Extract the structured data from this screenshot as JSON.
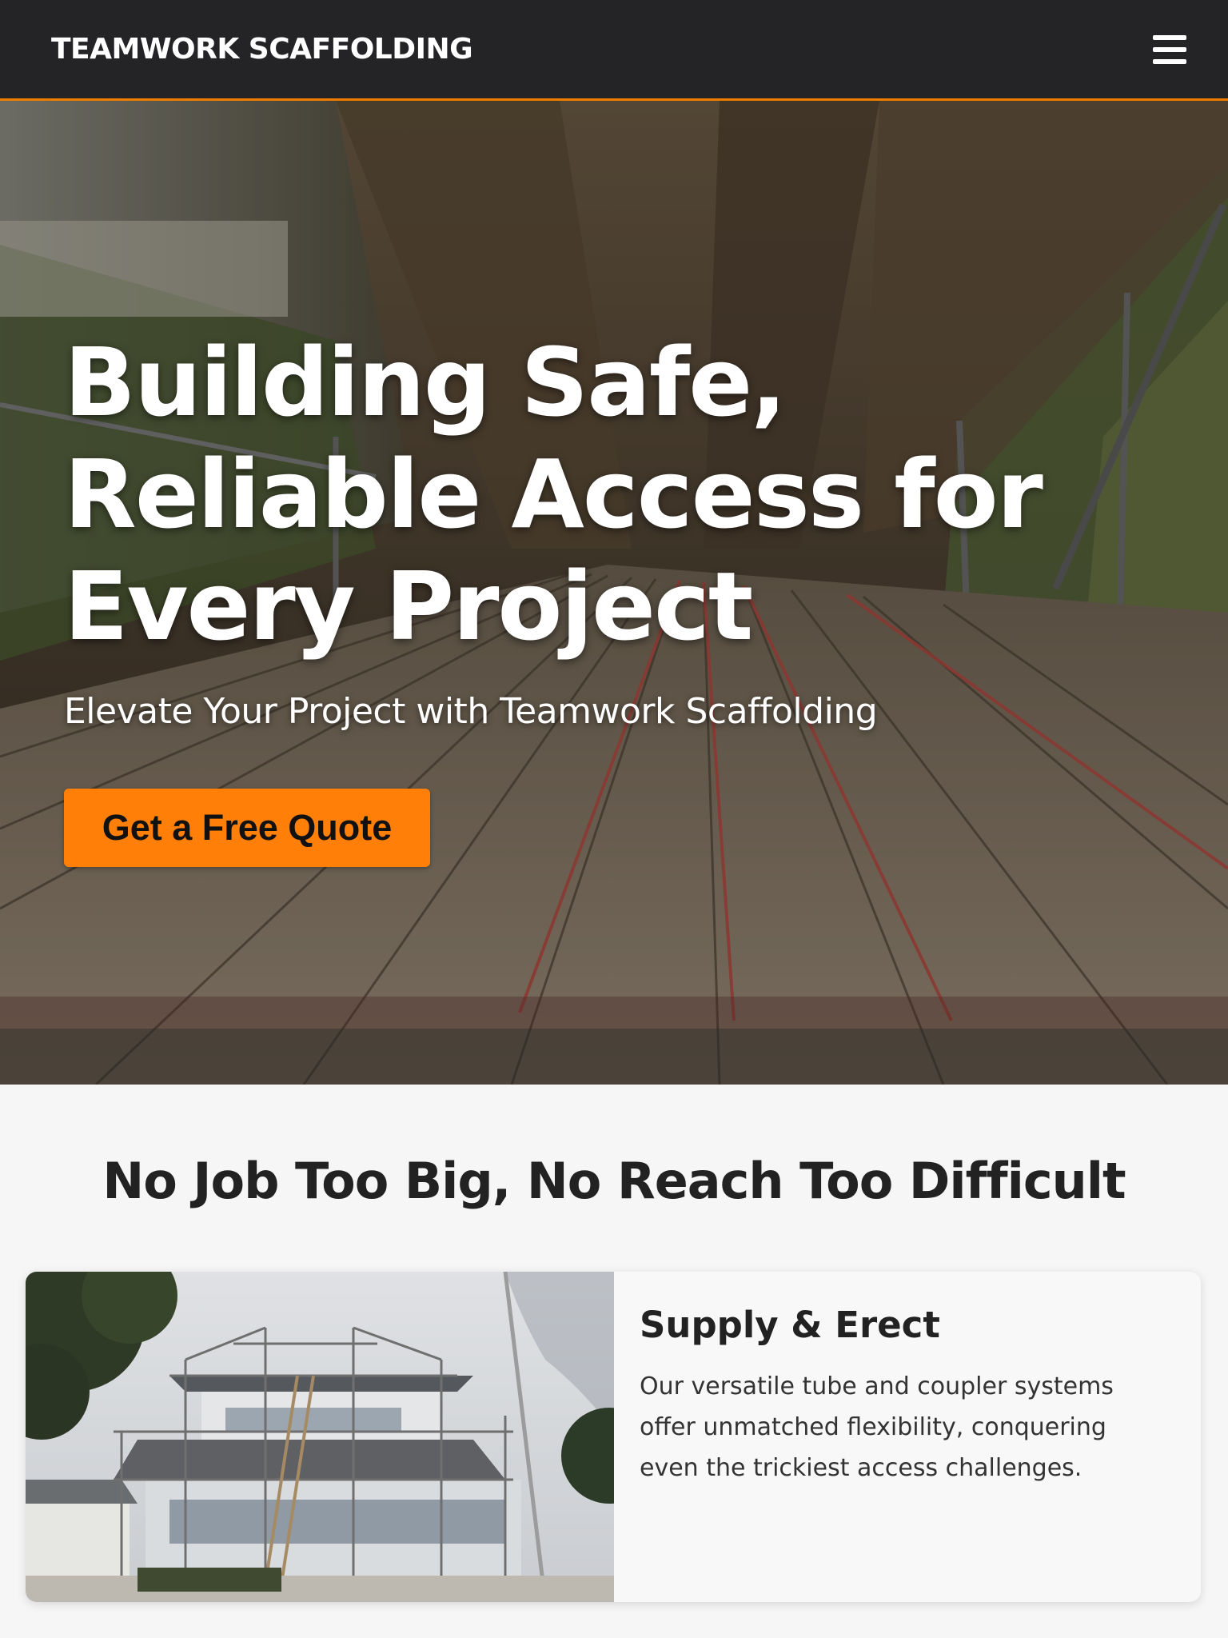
{
  "nav": {
    "brand": "TEAMWORK SCAFFOLDING",
    "menu_icon": "hamburger-menu-icon"
  },
  "hero": {
    "title": "Building Safe, Reliable Access for Every Project",
    "subtitle": "Elevate Your Project with Teamwork Scaffolding",
    "cta_label": "Get a Free Quote"
  },
  "services": {
    "heading": "No Job Too Big, No Reach Too Difficult",
    "cards": [
      {
        "title": "Supply & Erect",
        "text": "Our versatile tube and coupler systems offer unmatched flexibility, conquering even the trickiest access challenges."
      }
    ]
  },
  "colors": {
    "accent": "#ff7f08",
    "nav_bg": "#242426",
    "nav_border": "#f07d00"
  }
}
